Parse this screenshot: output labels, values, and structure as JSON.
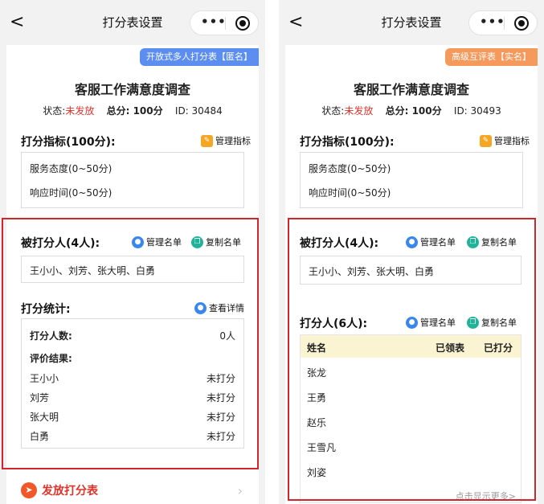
{
  "left": {
    "nav": {
      "back": "<",
      "title": "打分表设置",
      "menu": "•••"
    },
    "badge": "开放式多人打分表【匿名】",
    "survey_title": "客服工作满意度调查",
    "meta": {
      "status_label": "状态:",
      "status_value": "未发放",
      "score": "总分: 100分",
      "id": "ID: 30484"
    },
    "criteria": {
      "title": "打分指标(100分):",
      "manage": "管理指标",
      "items": [
        "服务态度(0~50分)",
        "响应时间(0~50分)"
      ]
    },
    "rated": {
      "title": "被打分人(4人):",
      "manage": "管理名单",
      "copy": "复制名单",
      "names": "王小小、刘芳、张大明、白勇"
    },
    "stats": {
      "title": "打分统计:",
      "detail": "查看详情",
      "count_label": "打分人数:",
      "count_value": "0人",
      "result_label": "评价结果:",
      "rows": [
        {
          "name": "王小小",
          "status": "未打分"
        },
        {
          "name": "刘芳",
          "status": "未打分"
        },
        {
          "name": "张大明",
          "status": "未打分"
        },
        {
          "name": "白勇",
          "status": "未打分"
        }
      ]
    },
    "publish": "发放打分表"
  },
  "right": {
    "nav": {
      "back": "<",
      "title": "打分表设置",
      "menu": "•••"
    },
    "badge": "高级互评表【实名】",
    "survey_title": "客服工作满意度调查",
    "meta": {
      "status_label": "状态:",
      "status_value": "未发放",
      "score": "总分: 100分",
      "id": "ID: 30493"
    },
    "criteria": {
      "title": "打分指标(100分):",
      "manage": "管理指标",
      "items": [
        "服务态度(0~50分)",
        "响应时间(0~50分)"
      ]
    },
    "rated": {
      "title": "被打分人(4人):",
      "manage": "管理名单",
      "copy": "复制名单",
      "names": "王小小、刘芳、张大明、白勇"
    },
    "raters": {
      "title": "打分人(6人):",
      "manage": "管理名单",
      "copy": "复制名单",
      "headers": [
        "姓名",
        "已领表",
        "已打分"
      ],
      "names": [
        "张龙",
        "王勇",
        "赵乐",
        "王雪凡",
        "刘姿"
      ],
      "more": "点击显示更多>"
    }
  },
  "colors": {
    "red_frame": "#d3262c",
    "status_red": "#e0322a",
    "badge_blue": "#5b8ef0",
    "badge_orange": "#f59a5c",
    "table_head": "#fbf4d2"
  }
}
